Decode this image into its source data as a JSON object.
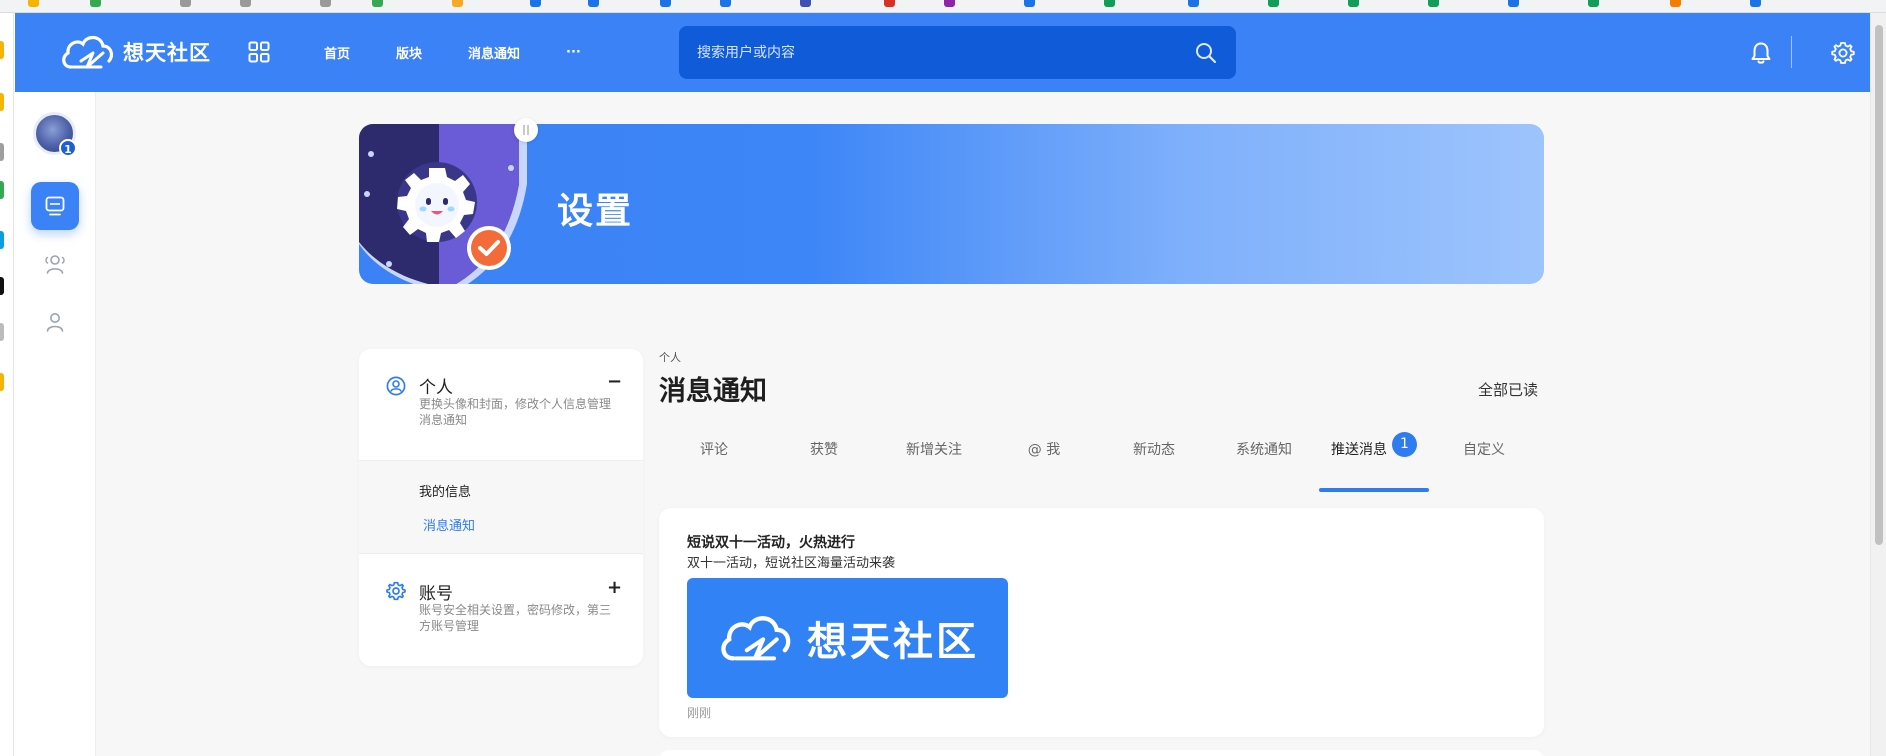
{
  "header": {
    "site_name": "想天社区",
    "nav": [
      "首页",
      "版块",
      "消息通知",
      "···"
    ],
    "search_placeholder": "搜索用户或内容"
  },
  "sidebar": {
    "avatar_badge": "1"
  },
  "banner": {
    "title": "设置"
  },
  "settings_panel": {
    "personal": {
      "title": "个人",
      "desc_line1": "更换头像和封面，修改个人信息管理",
      "desc_line2": "消息通知",
      "toggle": "−",
      "items": [
        "我的信息",
        "消息通知"
      ]
    },
    "account": {
      "title": "账号",
      "desc_line1": "账号安全相关设置，密码修改，第三",
      "desc_line2": "方账号管理",
      "toggle": "+"
    }
  },
  "content": {
    "breadcrumb": "个人",
    "title": "消息通知",
    "mark_all_read": "全部已读",
    "tabs": [
      "评论",
      "获赞",
      "新增关注",
      "@ 我",
      "新动态",
      "系统通知",
      "推送消息",
      "自定义"
    ],
    "active_tab": "推送消息",
    "active_tab_badge": "1",
    "message": {
      "title": "短说双十一活动，火热进行",
      "desc": "双十一活动，短说社区海量活动来袭",
      "image_text": "想天社区",
      "time": "刚刚"
    }
  },
  "colors": {
    "primary": "#3b82f6",
    "search_bg": "#0f5bd8",
    "tab_underline": "#2f7cf0",
    "page_bg": "#f7f7f8",
    "badge_orange": "#f26b38"
  }
}
